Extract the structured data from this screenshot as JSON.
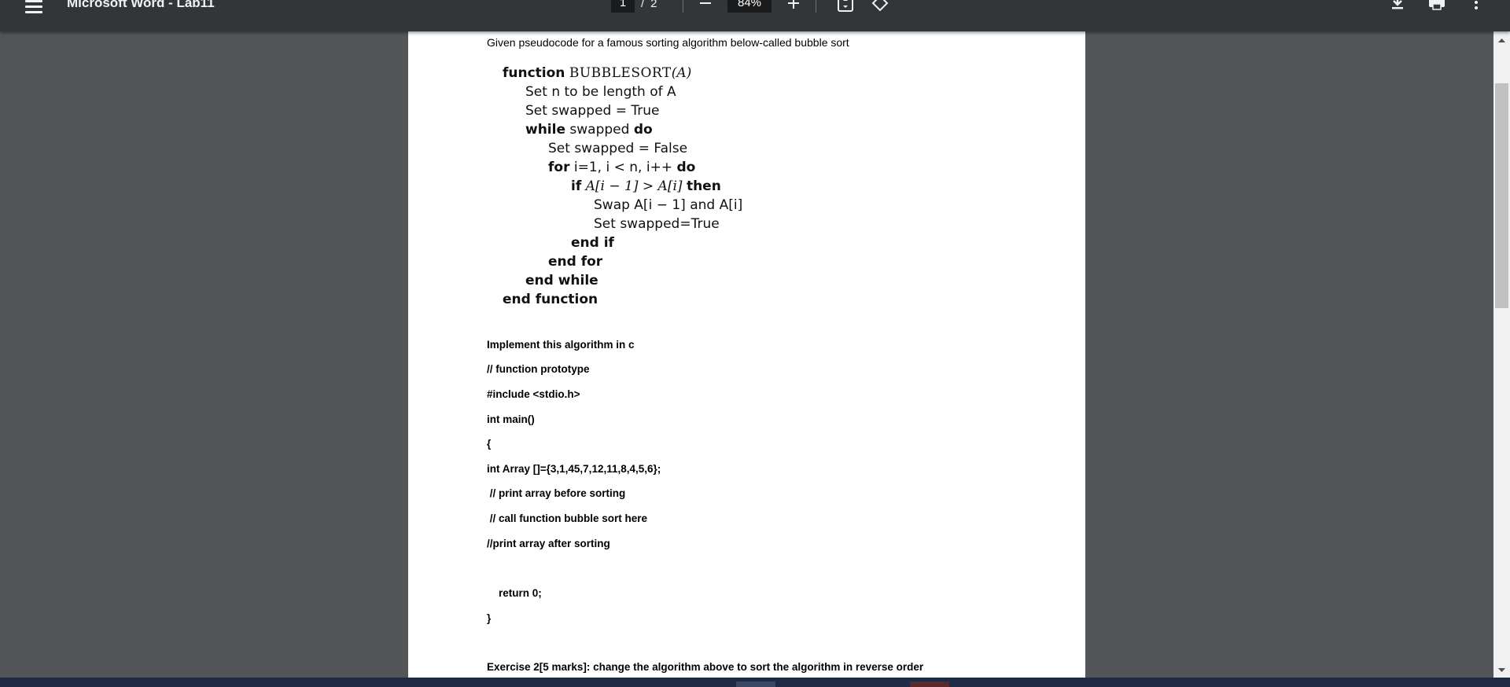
{
  "toolbar": {
    "title": "Microsoft Word - Lab11",
    "page_current": "1",
    "page_separator": "/",
    "page_total": "2",
    "zoom": "84%",
    "icons": [
      "menu-icon",
      "zoom-out-icon",
      "zoom-in-icon",
      "fit-page-icon",
      "rotate-icon",
      "download-icon",
      "print-icon",
      "more-icon"
    ]
  },
  "document": {
    "intro": "Given pseudocode for a famous sorting algorithm below-called bubble sort",
    "pseudocode": {
      "l1_kw": "function",
      "l1_name": "BUBBLESORT",
      "l1_arg": "(A)",
      "l2": "Set n to be length of A",
      "l3": "Set swapped = True",
      "l4_kw": "while",
      "l4_mid": "swapped",
      "l4_kw2": "do",
      "l5": "Set swapped = False",
      "l6_kw": "for",
      "l6_mid": "i=1, i < n, i++",
      "l6_kw2": "do",
      "l7_kw": "if",
      "l7_mid": "A[i − 1] > A[i]",
      "l7_kw2": "then",
      "l8": "Swap A[i − 1] and A[i]",
      "l9": "Set swapped=True",
      "l10": "end if",
      "l11": "end for",
      "l12": "end while",
      "l13": "end function"
    },
    "code_lines": [
      "Implement this algorithm in c",
      "// function prototype",
      "#include <stdio.h>",
      "int main()",
      "{",
      "int Array []={3,1,45,7,12,11,8,4,5,6};",
      " // print array before sorting",
      " // call function bubble sort here",
      "//print array after sorting",
      "    return 0;",
      "}",
      "Exercise 2[5 marks]: change the algorithm above to sort the algorithm in reverse order"
    ]
  },
  "colors": {
    "toolbar_bg": "#323639",
    "viewer_bg": "#525659",
    "page_bg": "#ffffff",
    "scrollbar_thumb": "#c1c1c1"
  }
}
